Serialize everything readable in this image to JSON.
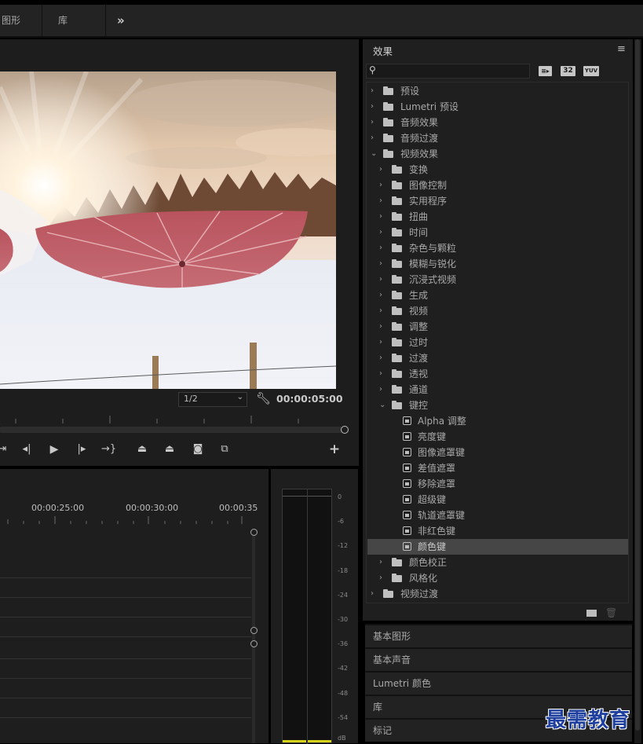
{
  "workspace": {
    "tabs": [
      "图形",
      "库"
    ],
    "overflow_icon": "double-chevron-right-icon"
  },
  "program_monitor": {
    "zoom_select": "1/2",
    "timecode": "00:00:05:00",
    "controls": [
      "mark-out-icon",
      "step-back-icon",
      "play-icon",
      "step-forward-icon",
      "go-to-out-icon",
      "lift-icon",
      "extract-icon",
      "camera-icon",
      "compare-icon",
      "add-icon"
    ]
  },
  "timeline": {
    "ruler": [
      "00:00:25:00",
      "00:00:30:00",
      "00:00:35"
    ]
  },
  "audio_meter": {
    "scale": [
      "0",
      "-6",
      "-12",
      "-18",
      "-24",
      "-30",
      "-36",
      "-42",
      "-48",
      "-54",
      "dB"
    ]
  },
  "effects_panel": {
    "title": "效果",
    "menu_icon": "hamburger-icon",
    "search_placeholder": "",
    "filter_badges": [
      "32",
      "YUV"
    ],
    "tree": [
      {
        "label": "预设",
        "level": 0,
        "icon": "preset-folder",
        "expanded": false
      },
      {
        "label": "Lumetri 预设",
        "level": 0,
        "icon": "preset-folder",
        "expanded": false
      },
      {
        "label": "音频效果",
        "level": 0,
        "icon": "folder",
        "expanded": false
      },
      {
        "label": "音频过渡",
        "level": 0,
        "icon": "folder",
        "expanded": false
      },
      {
        "label": "视频效果",
        "level": 0,
        "icon": "folder",
        "expanded": true
      },
      {
        "label": "变换",
        "level": 1,
        "icon": "folder",
        "expanded": false
      },
      {
        "label": "图像控制",
        "level": 1,
        "icon": "folder",
        "expanded": false
      },
      {
        "label": "实用程序",
        "level": 1,
        "icon": "folder",
        "expanded": false
      },
      {
        "label": "扭曲",
        "level": 1,
        "icon": "folder",
        "expanded": false
      },
      {
        "label": "时间",
        "level": 1,
        "icon": "folder",
        "expanded": false
      },
      {
        "label": "杂色与颗粒",
        "level": 1,
        "icon": "folder",
        "expanded": false
      },
      {
        "label": "模糊与锐化",
        "level": 1,
        "icon": "folder",
        "expanded": false
      },
      {
        "label": "沉浸式视频",
        "level": 1,
        "icon": "folder",
        "expanded": false
      },
      {
        "label": "生成",
        "level": 1,
        "icon": "folder",
        "expanded": false
      },
      {
        "label": "视频",
        "level": 1,
        "icon": "folder",
        "expanded": false
      },
      {
        "label": "调整",
        "level": 1,
        "icon": "folder",
        "expanded": false
      },
      {
        "label": "过时",
        "level": 1,
        "icon": "folder",
        "expanded": false
      },
      {
        "label": "过渡",
        "level": 1,
        "icon": "folder",
        "expanded": false
      },
      {
        "label": "透视",
        "level": 1,
        "icon": "folder",
        "expanded": false
      },
      {
        "label": "通道",
        "level": 1,
        "icon": "folder",
        "expanded": false
      },
      {
        "label": "键控",
        "level": 1,
        "icon": "folder",
        "expanded": true
      },
      {
        "label": "Alpha 调整",
        "level": 2,
        "icon": "effect"
      },
      {
        "label": "亮度键",
        "level": 2,
        "icon": "effect"
      },
      {
        "label": "图像遮罩键",
        "level": 2,
        "icon": "effect"
      },
      {
        "label": "差值遮罩",
        "level": 2,
        "icon": "effect"
      },
      {
        "label": "移除遮罩",
        "level": 2,
        "icon": "effect"
      },
      {
        "label": "超级键",
        "level": 2,
        "icon": "effect"
      },
      {
        "label": "轨道遮罩键",
        "level": 2,
        "icon": "effect"
      },
      {
        "label": "非红色键",
        "level": 2,
        "icon": "effect"
      },
      {
        "label": "颜色键",
        "level": 2,
        "icon": "effect",
        "selected": true
      },
      {
        "label": "颜色校正",
        "level": 1,
        "icon": "folder",
        "expanded": false
      },
      {
        "label": "风格化",
        "level": 1,
        "icon": "folder",
        "expanded": false
      },
      {
        "label": "视频过渡",
        "level": 0,
        "icon": "folder",
        "expanded": false
      }
    ]
  },
  "collapsed_panels": [
    "基本图形",
    "基本声音",
    "Lumetri 颜色",
    "库",
    "标记"
  ],
  "watermark": "最需教育",
  "colors": {
    "panel_bg": "#1f1f1f",
    "selection": "#464646",
    "watermark": "#1f3f9e",
    "meter_peak": "#d7d21a"
  }
}
